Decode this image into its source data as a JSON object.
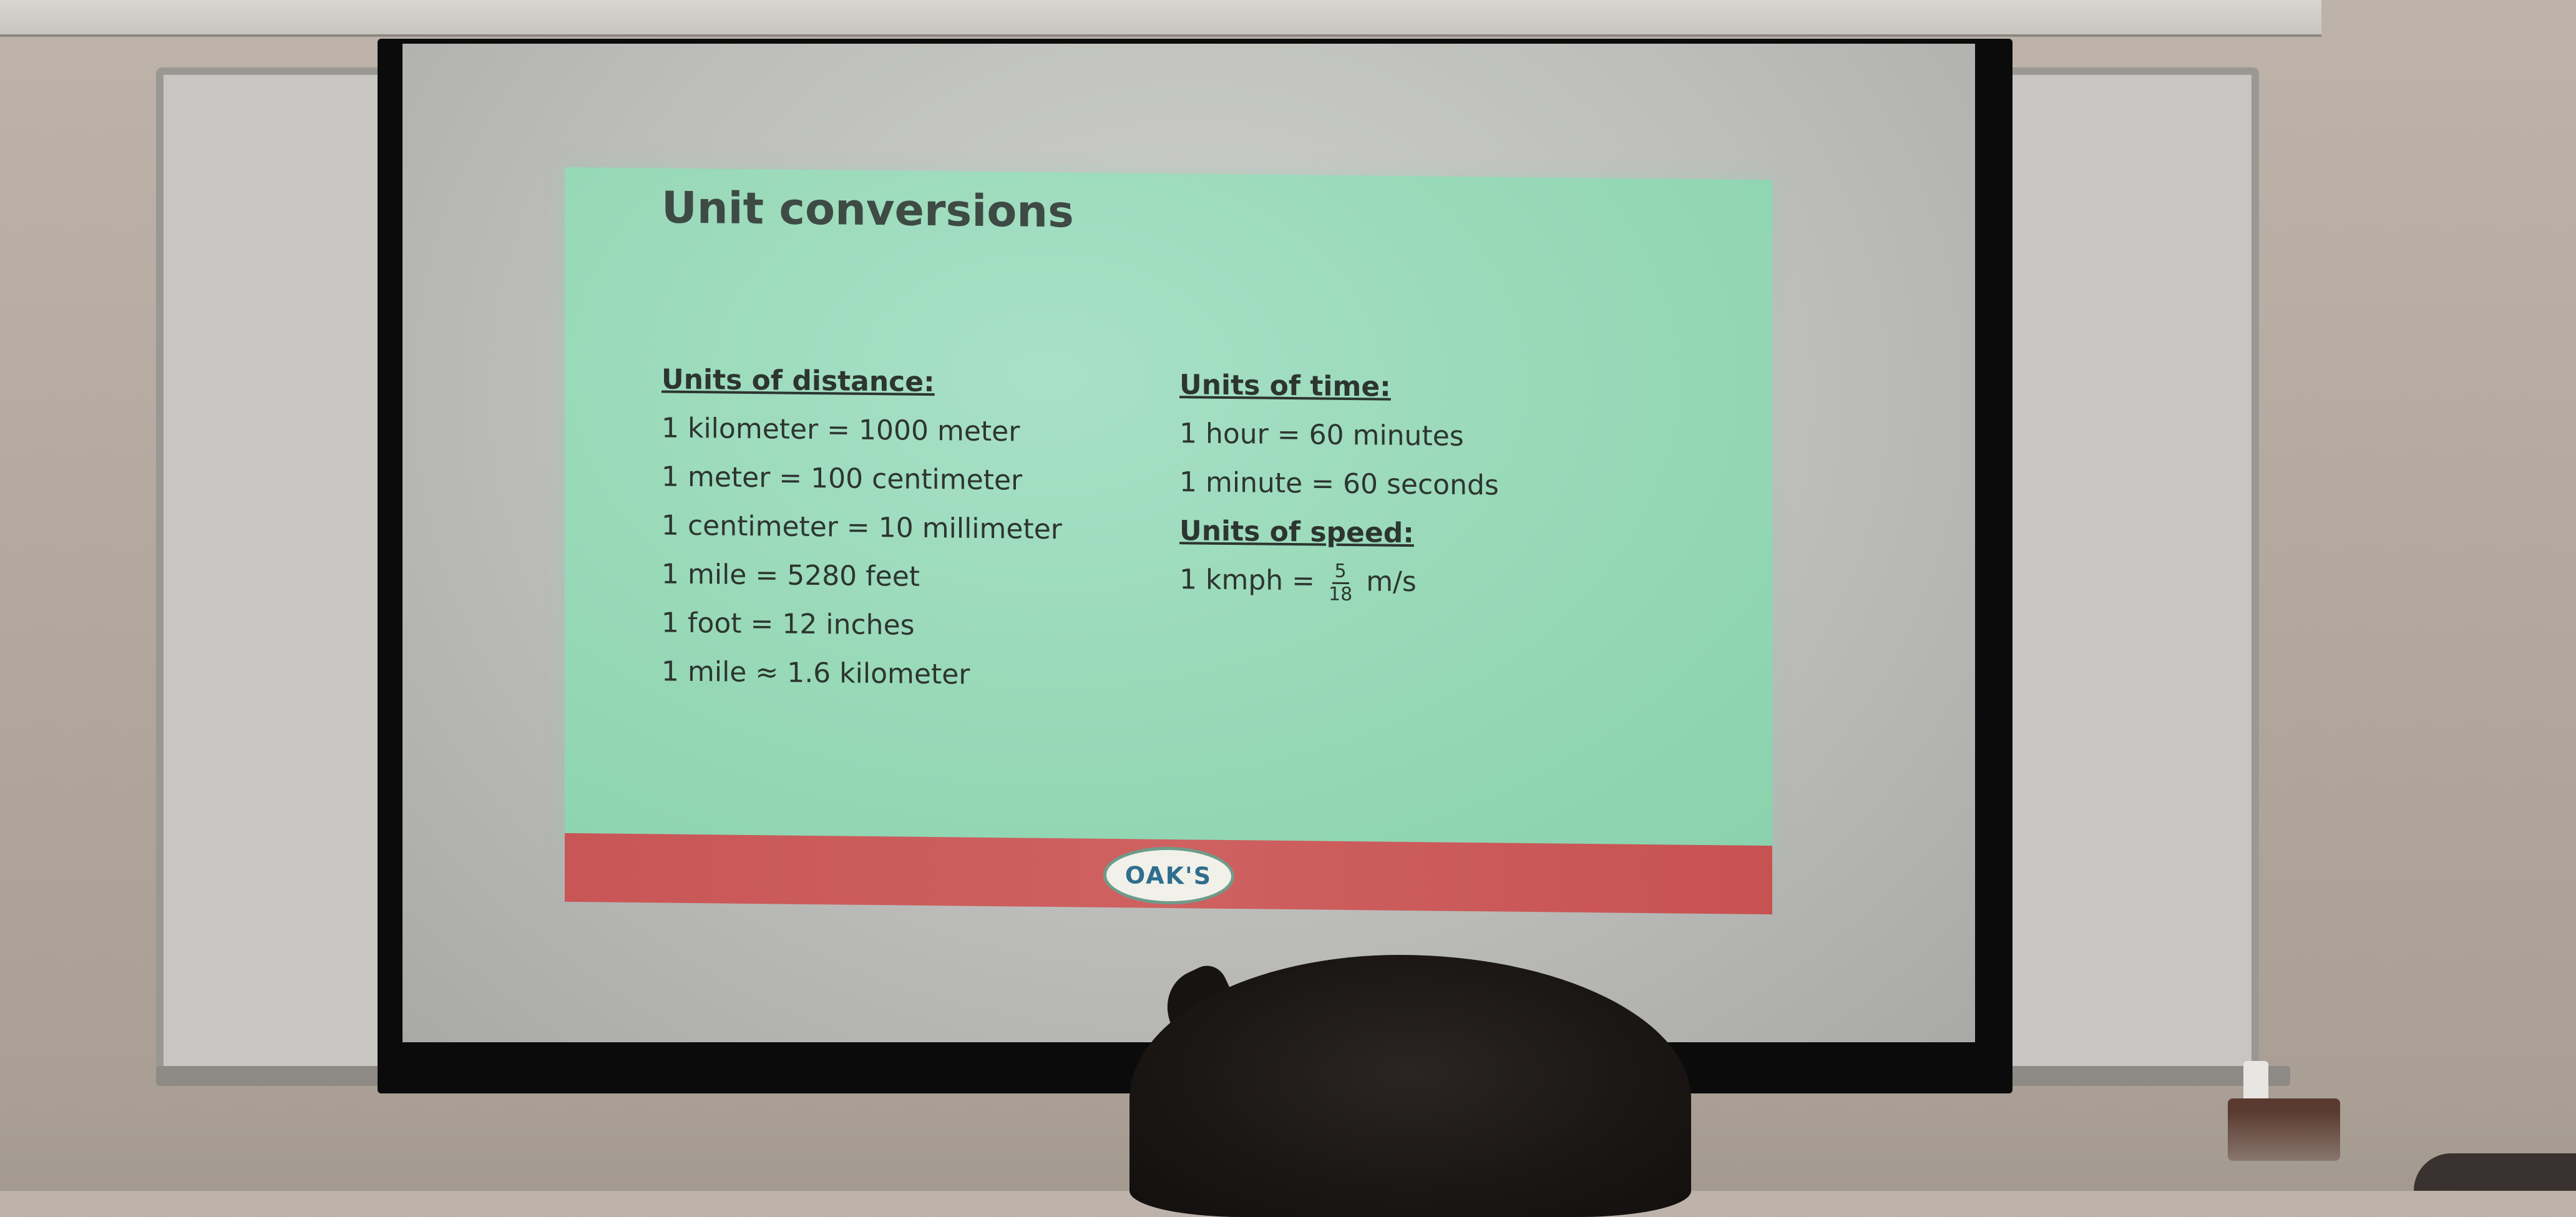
{
  "slide": {
    "title": "Unit conversions",
    "distance": {
      "heading": "Units of distance:",
      "lines": [
        "1 kilometer = 1000 meter",
        "1 meter = 100 centimeter",
        "1 centimeter = 10 millimeter",
        "1 mile = 5280 feet",
        "1 foot = 12 inches",
        "1 mile ≈ 1.6 kilometer"
      ]
    },
    "time": {
      "heading": "Units of time:",
      "lines": [
        "1 hour = 60 minutes",
        "1 minute = 60 seconds"
      ]
    },
    "speed": {
      "heading": "Units of speed:",
      "prefix": "1 kmph =",
      "numerator": "5",
      "denominator": "18",
      "suffix": "m/s"
    },
    "logo_text": "OAK'S"
  },
  "colors": {
    "slide_background": "#98d9b8",
    "footer_band": "#c95656",
    "text": "#2d3530"
  }
}
